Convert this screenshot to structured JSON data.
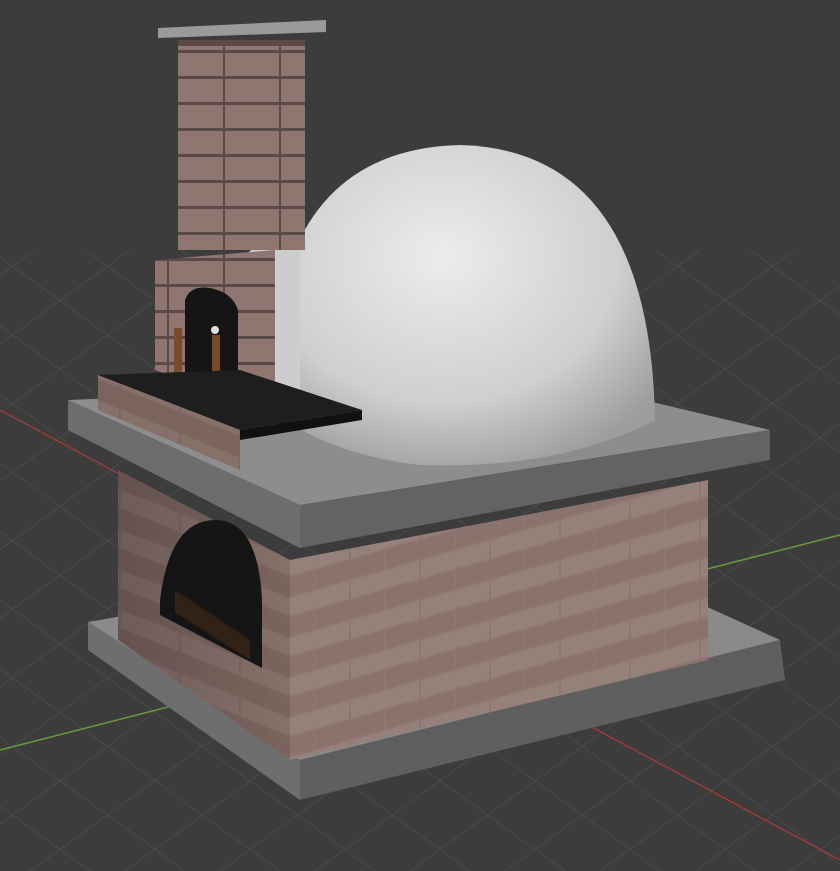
{
  "viewport": {
    "background": "#3c3c3c",
    "grid_color": "#4a4a4a",
    "axis_x_color": "#9b3a3a",
    "axis_y_color": "#6a9a3a"
  },
  "scene": {
    "object": "brick-oven-3d-model",
    "colors": {
      "brick": "#8f7670",
      "brick_dark": "#7a625d",
      "mortar": "#5b4a47",
      "concrete": "#8a8a8a",
      "concrete_side": "#6e6e6e",
      "dome": "#d9d9d9",
      "dome_shadow": "#a9a9a9",
      "opening": "#1a1a1a",
      "wood": "#7a4a2a",
      "shelf": "#1e1e1e"
    }
  }
}
